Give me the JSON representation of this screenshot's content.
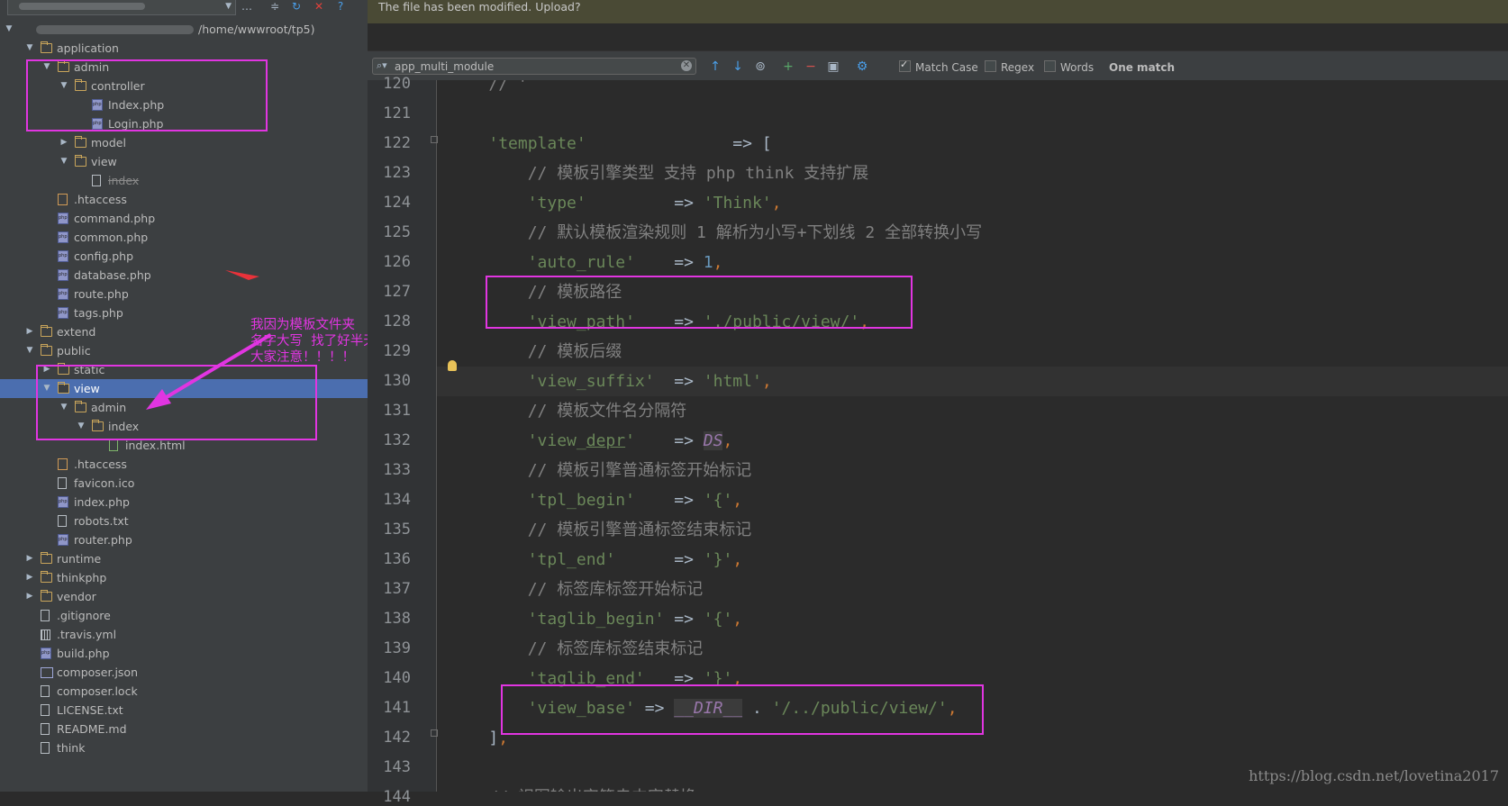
{
  "colors": {
    "highlight": "#e135e1",
    "selection": "#4b6eaf",
    "editor_bg": "#2b2b2b",
    "sidebar_bg": "#3c3f41"
  },
  "sidebar": {
    "root_path": "/home/wwwroot/tp5)",
    "tree": [
      {
        "label": "application",
        "icon": "folder",
        "open": true
      },
      {
        "label": "admin",
        "icon": "folder",
        "open": true
      },
      {
        "label": "controller",
        "icon": "folder",
        "open": true
      },
      {
        "label": "Index.php",
        "icon": "php"
      },
      {
        "label": "Login.php",
        "icon": "php"
      },
      {
        "label": "model",
        "icon": "folder",
        "open": false
      },
      {
        "label": "view",
        "icon": "folder",
        "open": true
      },
      {
        "label": "index",
        "icon": "file",
        "strike": true
      },
      {
        "label": ".htaccess",
        "icon": "ht"
      },
      {
        "label": "command.php",
        "icon": "php"
      },
      {
        "label": "common.php",
        "icon": "php"
      },
      {
        "label": "config.php",
        "icon": "php"
      },
      {
        "label": "database.php",
        "icon": "php"
      },
      {
        "label": "route.php",
        "icon": "php"
      },
      {
        "label": "tags.php",
        "icon": "php"
      },
      {
        "label": "extend",
        "icon": "folder",
        "open": false
      },
      {
        "label": "public",
        "icon": "folder",
        "open": true
      },
      {
        "label": "static",
        "icon": "folder",
        "open": false
      },
      {
        "label": "view",
        "icon": "folder",
        "open": true,
        "selected": true
      },
      {
        "label": "admin",
        "icon": "folder",
        "open": true
      },
      {
        "label": "index",
        "icon": "folder",
        "open": true
      },
      {
        "label": "index.html",
        "icon": "html"
      },
      {
        "label": ".htaccess",
        "icon": "ht"
      },
      {
        "label": "favicon.ico",
        "icon": "file"
      },
      {
        "label": "index.php",
        "icon": "php"
      },
      {
        "label": "robots.txt",
        "icon": "file"
      },
      {
        "label": "router.php",
        "icon": "php"
      },
      {
        "label": "runtime",
        "icon": "folder",
        "open": false
      },
      {
        "label": "thinkphp",
        "icon": "folder",
        "open": false
      },
      {
        "label": "vendor",
        "icon": "folder",
        "open": false
      },
      {
        "label": ".gitignore",
        "icon": "file"
      },
      {
        "label": ".travis.yml",
        "icon": "yml"
      },
      {
        "label": "build.php",
        "icon": "php"
      },
      {
        "label": "composer.json",
        "icon": "json"
      },
      {
        "label": "composer.lock",
        "icon": "file"
      },
      {
        "label": "LICENSE.txt",
        "icon": "file"
      },
      {
        "label": "README.md",
        "icon": "file"
      },
      {
        "label": "think",
        "icon": "file"
      }
    ],
    "annotation": "我因为模板文件夹\n名字大写  找了好半天\n大家注意！！！！"
  },
  "editor": {
    "notification": "The file has been modified. Upload?",
    "search": {
      "query": "app_multi_module",
      "match_case_label": "Match Case",
      "match_case": true,
      "regex_label": "Regex",
      "regex": false,
      "words_label": "Words",
      "words": false,
      "result": "One match"
    },
    "lines": [
      {
        "n": "120",
        "html": "    <span class=\"c\">// '</span>"
      },
      {
        "n": "121",
        "html": ""
      },
      {
        "n": "122",
        "html": "    <span class=\"s\">'template'</span>               => ["
      },
      {
        "n": "123",
        "html": "        <span class=\"c\">// 模板引擎类型 支持 php think 支持扩展</span>"
      },
      {
        "n": "124",
        "html": "        <span class=\"s\">'type'</span>         => <span class=\"s\">'Think'</span><span class=\"k\">,</span>"
      },
      {
        "n": "125",
        "html": "        <span class=\"c\">// 默认模板渲染规则 1 解析为小写+下划线 2 全部转换小写</span>"
      },
      {
        "n": "126",
        "html": "        <span class=\"s\">'auto_rule'</span>    => <span class=\"n\">1</span><span class=\"k\">,</span>"
      },
      {
        "n": "127",
        "html": "        <span class=\"c\">// 模板路径</span>"
      },
      {
        "n": "128",
        "html": "        <span class=\"s\">'view_path'</span>    => <span class=\"s\">'./public/view/'</span><span class=\"k\">,</span>"
      },
      {
        "n": "129",
        "html": "        <span class=\"c\">// 模板后缀</span>"
      },
      {
        "n": "130",
        "html": "        <span class=\"s\">'view_suffix'</span>  => <span class=\"s\">'html'</span><span class=\"k\">,</span>"
      },
      {
        "n": "131",
        "html": "        <span class=\"c\">// 模板文件名分隔符</span>"
      },
      {
        "n": "132",
        "html": "        <span class=\"s\">'view_<span class=\"uscore\">depr</span>'</span>    => <span class=\"const\">DS</span><span class=\"k\">,</span>"
      },
      {
        "n": "133",
        "html": "        <span class=\"c\">// 模板引擎普通标签开始标记</span>"
      },
      {
        "n": "134",
        "html": "        <span class=\"s\">'tpl_begin'</span>    => <span class=\"s\">'{'</span><span class=\"k\">,</span>"
      },
      {
        "n": "135",
        "html": "        <span class=\"c\">// 模板引擎普通标签结束标记</span>"
      },
      {
        "n": "136",
        "html": "        <span class=\"s\">'tpl_end'</span>      => <span class=\"s\">'}'</span><span class=\"k\">,</span>"
      },
      {
        "n": "137",
        "html": "        <span class=\"c\">// 标签库标签开始标记</span>"
      },
      {
        "n": "138",
        "html": "        <span class=\"s\">'taglib_begin'</span> => <span class=\"s\">'{'</span><span class=\"k\">,</span>"
      },
      {
        "n": "139",
        "html": "        <span class=\"c\">// 标签库标签结束标记</span>"
      },
      {
        "n": "140",
        "html": "        <span class=\"s\">'taglib_end'</span>   => <span class=\"s\">'}'</span><span class=\"k\">,</span>"
      },
      {
        "n": "141",
        "html": "        <span class=\"s\">'view_base'</span> => <span class=\"const\">__DIR__</span> . <span class=\"s\">'/../public/view/'</span><span class=\"k\">,</span>"
      },
      {
        "n": "142",
        "html": "    ]<span class=\"k\">,</span>"
      },
      {
        "n": "143",
        "html": ""
      },
      {
        "n": "144",
        "html": "    <span class=\"c\">// 视图输出字符串内容替换</span>"
      }
    ]
  },
  "watermark": "https://blog.csdn.net/lovetina2017"
}
